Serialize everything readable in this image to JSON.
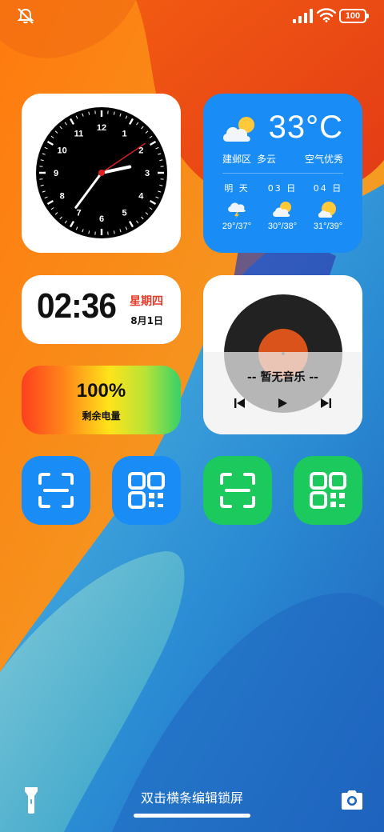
{
  "status_bar": {
    "battery_level": "100"
  },
  "clock": {
    "numerals": [
      "12",
      "1",
      "2",
      "3",
      "4",
      "5",
      "6",
      "7",
      "8",
      "9",
      "10",
      "11"
    ],
    "hour": 2,
    "minute": 36,
    "second": 6
  },
  "weather": {
    "temperature": "33°C",
    "location": "建邺区",
    "condition": "多云",
    "air_quality": "空气优秀",
    "forecast": [
      {
        "day": "明 天",
        "range": "29°/37°",
        "icon": "thunderstorm-icon"
      },
      {
        "day": "03 日",
        "range": "30°/38°",
        "icon": "partly-cloudy-icon"
      },
      {
        "day": "04 日",
        "range": "31°/39°",
        "icon": "partly-cloudy-icon"
      }
    ]
  },
  "digital_clock": {
    "time": "02:36",
    "weekday": "星期四",
    "date": "8月1日"
  },
  "battery_widget": {
    "percent": "100%",
    "label": "剩余电量"
  },
  "music": {
    "status": "-- 暂无音乐 --"
  },
  "shortcuts": [
    {
      "icon": "scan-icon",
      "color": "#1a8cf5"
    },
    {
      "icon": "qr-code-icon",
      "color": "#1a8cf5"
    },
    {
      "icon": "scan-icon",
      "color": "#1bc95c"
    },
    {
      "icon": "qr-code-icon",
      "color": "#1bc95c"
    }
  ],
  "bottom": {
    "hint": "双击横条编辑锁屏"
  },
  "colors": {
    "accent_blue": "#1a8cf5",
    "accent_green": "#1bc95c",
    "weekday_red": "#e43c2a"
  }
}
